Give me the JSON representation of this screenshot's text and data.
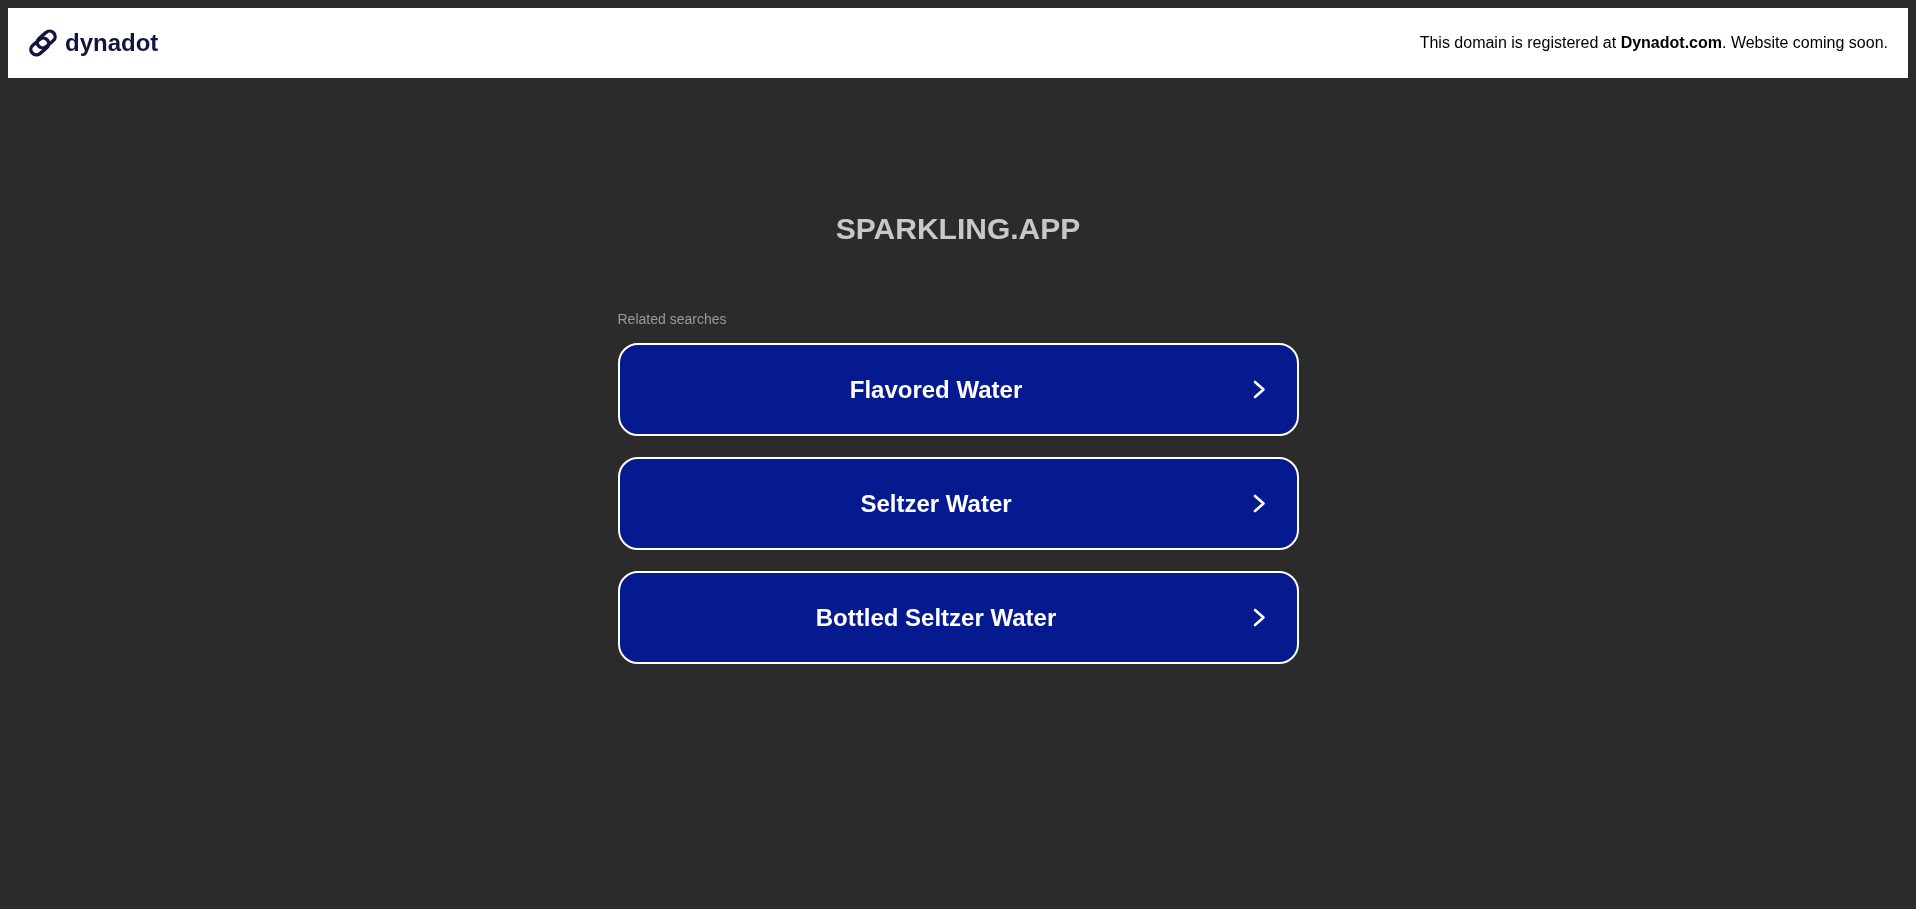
{
  "header": {
    "logo_text": "dynadot",
    "notice": "This domain is registered at **Dynadot.com**. Website coming soon."
  },
  "domain_title": "SPARKLING.APP",
  "related_searches": {
    "label": "Related searches",
    "items": [
      {
        "label": "Flavored Water"
      },
      {
        "label": "Seltzer Water"
      },
      {
        "label": "Bottled Seltzer Water"
      }
    ]
  }
}
